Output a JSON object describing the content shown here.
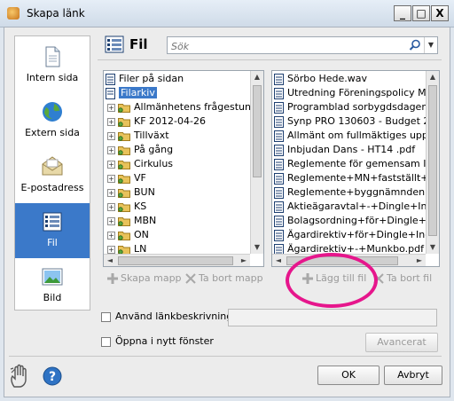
{
  "window": {
    "title": "Skapa länk",
    "controls": {
      "minimize": "_",
      "maximize": "□",
      "close": "X"
    }
  },
  "sidebar": {
    "items": [
      {
        "label": "Intern sida",
        "icon": "page-icon"
      },
      {
        "label": "Extern sida",
        "icon": "globe-icon"
      },
      {
        "label": "E-postadress",
        "icon": "envelope-icon"
      },
      {
        "label": "Fil",
        "icon": "file-list-icon",
        "active": true
      },
      {
        "label": "Bild",
        "icon": "image-icon"
      }
    ]
  },
  "panel": {
    "title": "Fil"
  },
  "search": {
    "placeholder": "Sök",
    "value": ""
  },
  "tree": {
    "root": "Filer på sidan",
    "selected": "Filarkiv",
    "folders": [
      "Allmänhetens frågestund",
      "KF 2012-04-26",
      "Tillväxt",
      "På gång",
      "Cirkulus",
      "VF",
      "BUN",
      "KS",
      "MBN",
      "ON",
      "LN"
    ]
  },
  "files": [
    "Sörbo Hede.wav",
    "Utredning Föreningspolicy Mu",
    "Programblad sorbygdsdagen.",
    "Synp PRO 130603 - Budget 2",
    "Allmänt om fullmäktiges uppdr",
    "Inbjudan Dans - HT14 .pdf",
    "Reglemente för gemensam IT",
    "Reglemente+MN+fastställt+k",
    "Reglemente+byggnämnden+",
    "Aktieägaravtal+-+Dingle+Ind",
    "Bolagsordning+för+Dingle+In",
    "Ägardirektiv+för+Dingle+Ind",
    "Ägardirektiv+-+Munkbo.pdf"
  ],
  "actions": {
    "create_folder": "Skapa mapp",
    "delete_folder": "Ta bort mapp",
    "add_file": "Lägg till fil",
    "delete_file": "Ta bort fil"
  },
  "options": {
    "use_description": "Använd länkbeskrivning:",
    "description_value": "",
    "open_new_window": "Öppna i nytt fönster",
    "advanced": "Avancerat"
  },
  "footer": {
    "ok": "OK",
    "cancel": "Avbryt"
  },
  "colors": {
    "selection": "#3b79c9",
    "annotation_circle": "#e6168c"
  }
}
